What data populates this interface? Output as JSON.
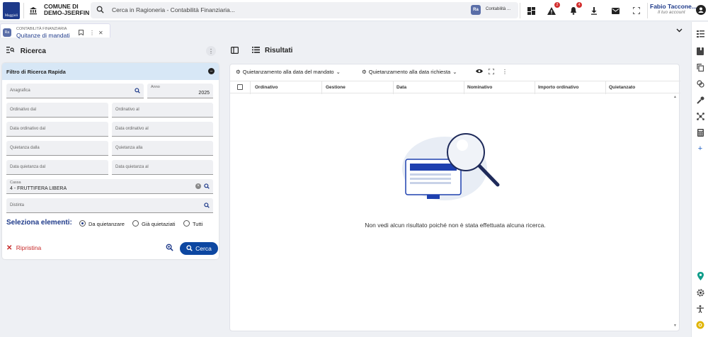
{
  "header": {
    "org_line1": "COMUNE DI",
    "org_line2": "DEMO-JSERFIN",
    "search_placeholder": "Cerca in Ragioneria - Contabilità Finanziaria...",
    "context_badge": "Ra",
    "context_label": "Contabilità ...",
    "alerts_count": "2",
    "notifications_count": "4",
    "user_name": "Fabio Taccone...",
    "user_sub": "Il tuo account"
  },
  "tab": {
    "badge": "Ra",
    "module": "CONTABILITÀ FINANZIARIA",
    "title": "Quitanze di mandati"
  },
  "left": {
    "title": "Ricerca",
    "filter_title": "Filtro di Ricerca Rapida",
    "fields": {
      "anagrafica": "Anagrafica",
      "anno_label": "Anno",
      "anno_value": "2025",
      "ordinativo_dal": "Ordinativo dal",
      "ordinativo_al": "Ordinativo al",
      "data_ord_dal": "Data ordinativo dal",
      "data_ord_al": "Data ordinativo al",
      "quietanza_dalla": "Quietanza dalla",
      "quietanza_alla": "Quietanza alla",
      "data_q_dal": "Data quietanza dal",
      "data_q_al": "Data quietanza al",
      "cassa_label": "Cassa",
      "cassa_value": "4 - FRUTTIFERA LIBERA",
      "distinta": "Distinta"
    },
    "select_label": "Seleziona elementi:",
    "radios": [
      "Da quietanzare",
      "Già quietaziati",
      "Tutti"
    ],
    "reset_label": "Ripristina",
    "search_label": "Cerca"
  },
  "right": {
    "title": "Risultati",
    "toolbar": {
      "btn1": "Quietanzamento alla data del mandato",
      "btn2": "Quietanzamento alla data richiesta"
    },
    "columns": [
      "Ordinativo",
      "Gestione",
      "Data",
      "Nominativo",
      "Importo ordinativo",
      "Quietanzato"
    ],
    "empty_message": "Non vedi alcun risultato poiché non è stata effettuata alcuna ricerca."
  },
  "icons": [
    "bank-icon",
    "search-icon",
    "dashboard-icon",
    "warning-icon",
    "bell-icon",
    "download-icon",
    "mail-icon",
    "fullscreen-icon",
    "account-icon"
  ]
}
